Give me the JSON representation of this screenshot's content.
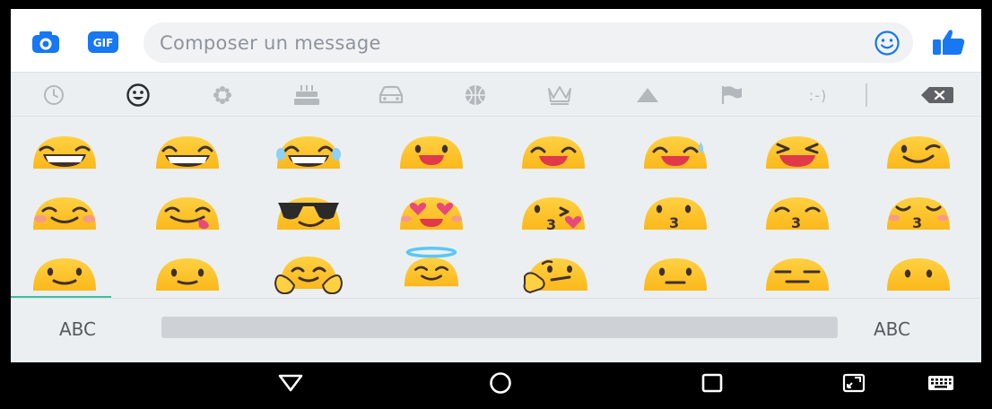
{
  "compose": {
    "placeholder": "Composer un message",
    "camera_icon": "camera-icon",
    "gif_label": "GIF",
    "smiley_icon": "smiley-icon",
    "like_icon": "thumbs-up-icon",
    "accent_color": "#1877f2"
  },
  "emoji_categories": [
    {
      "name": "recent",
      "icon": "clock-icon",
      "selected": false
    },
    {
      "name": "smileys",
      "icon": "smiley-icon",
      "selected": true
    },
    {
      "name": "nature",
      "icon": "flower-icon",
      "selected": false
    },
    {
      "name": "food",
      "icon": "cake-icon",
      "selected": false
    },
    {
      "name": "travel",
      "icon": "car-icon",
      "selected": false
    },
    {
      "name": "activities",
      "icon": "ball-icon",
      "selected": false
    },
    {
      "name": "objects",
      "icon": "crown-icon",
      "selected": false
    },
    {
      "name": "symbols",
      "icon": "triangle-icon",
      "selected": false
    },
    {
      "name": "flags",
      "icon": "flag-icon",
      "selected": false
    },
    {
      "name": "emoticons",
      "icon": "emoticon-text",
      "label": ":-)",
      "selected": false
    }
  ],
  "backspace_icon": "backspace-icon",
  "emoji_rows": [
    [
      "grinning",
      "grin",
      "joy",
      "smiley",
      "smile",
      "sweat-smile",
      "laughing",
      "wink"
    ],
    [
      "blush",
      "yum",
      "sunglasses",
      "heart-eyes",
      "kissing-heart",
      "kissing",
      "kissing-smiling-eyes",
      "kissing-closed-eyes"
    ],
    [
      "slightly-smiling",
      "slightly-smiling-2",
      "hugging",
      "innocent",
      "thinking",
      "neutral",
      "expressionless",
      "no-mouth"
    ]
  ],
  "keyboard": {
    "abc_left": "ABC",
    "abc_right": "ABC",
    "tab_indicator_color": "#3dbfa0"
  },
  "navbar": {
    "back_icon": "back-triangle-icon",
    "home_icon": "home-circle-icon",
    "recents_icon": "recents-square-icon",
    "screen_icon": "screen-resize-icon",
    "keyboard_icon": "keyboard-icon"
  }
}
